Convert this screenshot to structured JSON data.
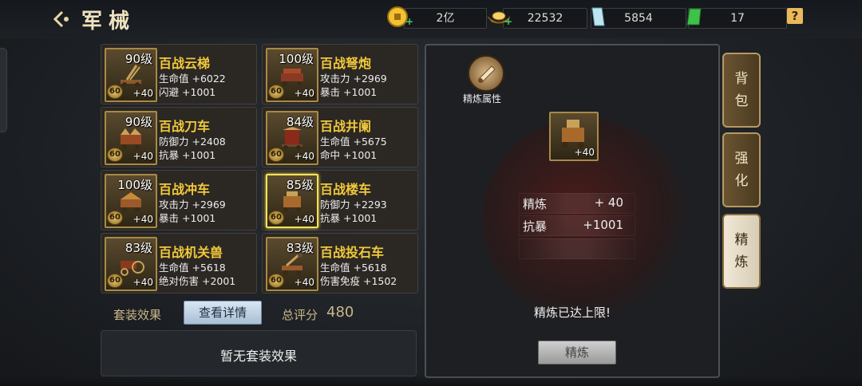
{
  "header": {
    "title": "军械",
    "help": "?"
  },
  "resources": [
    {
      "name": "copper-coin",
      "value": "2亿"
    },
    {
      "name": "gold-ingot",
      "value": "22532"
    },
    {
      "name": "crystal",
      "value": "5854"
    },
    {
      "name": "jade",
      "value": "17"
    }
  ],
  "items": [
    {
      "level": "90级",
      "name": "百战云梯",
      "stat1": "生命值 +6022",
      "stat2": "闪避 +1001",
      "badge": "60",
      "plus": "+40"
    },
    {
      "level": "100级",
      "name": "百战弩炮",
      "stat1": "攻击力 +2969",
      "stat2": "暴击 +1001",
      "badge": "60",
      "plus": "+40"
    },
    {
      "level": "90级",
      "name": "百战刀车",
      "stat1": "防御力 +2408",
      "stat2": "抗暴 +1001",
      "badge": "60",
      "plus": "+40"
    },
    {
      "level": "84级",
      "name": "百战井阑",
      "stat1": "生命值 +5675",
      "stat2": "命中 +1001",
      "badge": "60",
      "plus": "+40"
    },
    {
      "level": "100级",
      "name": "百战冲车",
      "stat1": "攻击力 +2969",
      "stat2": "暴击 +1001",
      "badge": "60",
      "plus": "+40"
    },
    {
      "level": "85级",
      "name": "百战楼车",
      "stat1": "防御力 +2293",
      "stat2": "抗暴 +1001",
      "badge": "60",
      "plus": "+40"
    },
    {
      "level": "83级",
      "name": "百战机关兽",
      "stat1": "生命值 +5618",
      "stat2": "绝对伤害 +2001",
      "badge": "60",
      "plus": "+40"
    },
    {
      "level": "83级",
      "name": "百战投石车",
      "stat1": "生命值 +5618",
      "stat2": "伤害免疫 +1502",
      "badge": "60",
      "plus": "+40"
    }
  ],
  "set": {
    "label": "套装效果",
    "detail_button": "查看详情",
    "score_label": "总评分",
    "score": "480",
    "none_text": "暂无套装效果"
  },
  "refine_panel": {
    "attr_label": "精炼属性",
    "icon_plus": "+40",
    "rows": [
      {
        "key": "精炼",
        "value": "+ 40"
      },
      {
        "key": "抗暴",
        "value": "+1001"
      }
    ],
    "max_text": "精炼已达上限!",
    "button": "精炼"
  },
  "side_tabs": [
    {
      "c1": "背",
      "c2": "包"
    },
    {
      "c1": "强",
      "c2": "化"
    },
    {
      "c1": "精",
      "c2": "炼"
    }
  ],
  "colors": {
    "accent_gold": "#f2c93a",
    "selected_border": "#f3e25a",
    "active_tab": "#e6dcc6"
  }
}
